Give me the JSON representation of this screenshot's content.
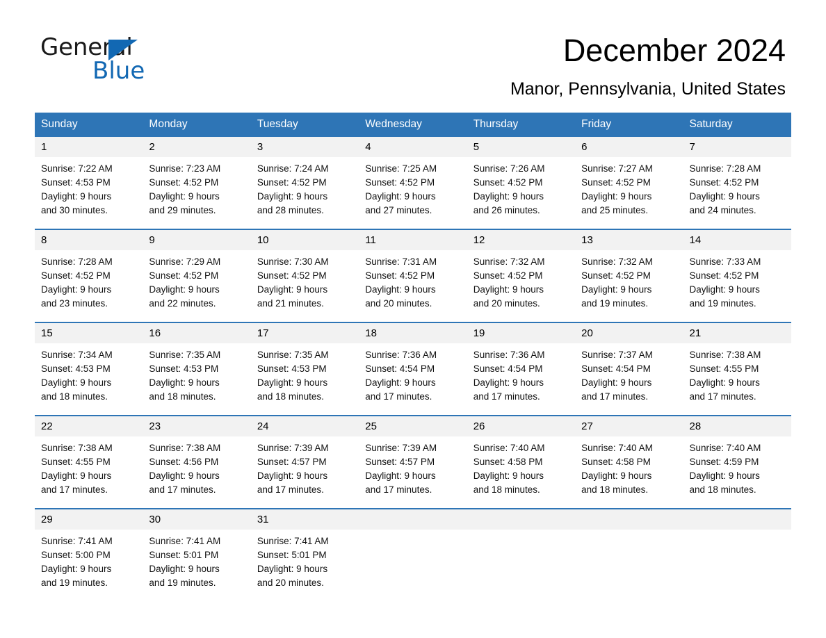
{
  "brand": {
    "name_part1": "General",
    "name_part2": "Blue",
    "triangle_color": "#1268b3"
  },
  "header": {
    "month_title": "December 2024",
    "location": "Manor, Pennsylvania, United States",
    "header_bg_color": "#2e75b6",
    "daynum_bg_color": "#f2f2f2"
  },
  "weekday_headers": [
    "Sunday",
    "Monday",
    "Tuesday",
    "Wednesday",
    "Thursday",
    "Friday",
    "Saturday"
  ],
  "weeks": [
    {
      "days": [
        {
          "num": "1",
          "sunrise": "Sunrise: 7:22 AM",
          "sunset": "Sunset: 4:53 PM",
          "daylight_l1": "Daylight: 9 hours",
          "daylight_l2": "and 30 minutes."
        },
        {
          "num": "2",
          "sunrise": "Sunrise: 7:23 AM",
          "sunset": "Sunset: 4:52 PM",
          "daylight_l1": "Daylight: 9 hours",
          "daylight_l2": "and 29 minutes."
        },
        {
          "num": "3",
          "sunrise": "Sunrise: 7:24 AM",
          "sunset": "Sunset: 4:52 PM",
          "daylight_l1": "Daylight: 9 hours",
          "daylight_l2": "and 28 minutes."
        },
        {
          "num": "4",
          "sunrise": "Sunrise: 7:25 AM",
          "sunset": "Sunset: 4:52 PM",
          "daylight_l1": "Daylight: 9 hours",
          "daylight_l2": "and 27 minutes."
        },
        {
          "num": "5",
          "sunrise": "Sunrise: 7:26 AM",
          "sunset": "Sunset: 4:52 PM",
          "daylight_l1": "Daylight: 9 hours",
          "daylight_l2": "and 26 minutes."
        },
        {
          "num": "6",
          "sunrise": "Sunrise: 7:27 AM",
          "sunset": "Sunset: 4:52 PM",
          "daylight_l1": "Daylight: 9 hours",
          "daylight_l2": "and 25 minutes."
        },
        {
          "num": "7",
          "sunrise": "Sunrise: 7:28 AM",
          "sunset": "Sunset: 4:52 PM",
          "daylight_l1": "Daylight: 9 hours",
          "daylight_l2": "and 24 minutes."
        }
      ]
    },
    {
      "days": [
        {
          "num": "8",
          "sunrise": "Sunrise: 7:28 AM",
          "sunset": "Sunset: 4:52 PM",
          "daylight_l1": "Daylight: 9 hours",
          "daylight_l2": "and 23 minutes."
        },
        {
          "num": "9",
          "sunrise": "Sunrise: 7:29 AM",
          "sunset": "Sunset: 4:52 PM",
          "daylight_l1": "Daylight: 9 hours",
          "daylight_l2": "and 22 minutes."
        },
        {
          "num": "10",
          "sunrise": "Sunrise: 7:30 AM",
          "sunset": "Sunset: 4:52 PM",
          "daylight_l1": "Daylight: 9 hours",
          "daylight_l2": "and 21 minutes."
        },
        {
          "num": "11",
          "sunrise": "Sunrise: 7:31 AM",
          "sunset": "Sunset: 4:52 PM",
          "daylight_l1": "Daylight: 9 hours",
          "daylight_l2": "and 20 minutes."
        },
        {
          "num": "12",
          "sunrise": "Sunrise: 7:32 AM",
          "sunset": "Sunset: 4:52 PM",
          "daylight_l1": "Daylight: 9 hours",
          "daylight_l2": "and 20 minutes."
        },
        {
          "num": "13",
          "sunrise": "Sunrise: 7:32 AM",
          "sunset": "Sunset: 4:52 PM",
          "daylight_l1": "Daylight: 9 hours",
          "daylight_l2": "and 19 minutes."
        },
        {
          "num": "14",
          "sunrise": "Sunrise: 7:33 AM",
          "sunset": "Sunset: 4:52 PM",
          "daylight_l1": "Daylight: 9 hours",
          "daylight_l2": "and 19 minutes."
        }
      ]
    },
    {
      "days": [
        {
          "num": "15",
          "sunrise": "Sunrise: 7:34 AM",
          "sunset": "Sunset: 4:53 PM",
          "daylight_l1": "Daylight: 9 hours",
          "daylight_l2": "and 18 minutes."
        },
        {
          "num": "16",
          "sunrise": "Sunrise: 7:35 AM",
          "sunset": "Sunset: 4:53 PM",
          "daylight_l1": "Daylight: 9 hours",
          "daylight_l2": "and 18 minutes."
        },
        {
          "num": "17",
          "sunrise": "Sunrise: 7:35 AM",
          "sunset": "Sunset: 4:53 PM",
          "daylight_l1": "Daylight: 9 hours",
          "daylight_l2": "and 18 minutes."
        },
        {
          "num": "18",
          "sunrise": "Sunrise: 7:36 AM",
          "sunset": "Sunset: 4:54 PM",
          "daylight_l1": "Daylight: 9 hours",
          "daylight_l2": "and 17 minutes."
        },
        {
          "num": "19",
          "sunrise": "Sunrise: 7:36 AM",
          "sunset": "Sunset: 4:54 PM",
          "daylight_l1": "Daylight: 9 hours",
          "daylight_l2": "and 17 minutes."
        },
        {
          "num": "20",
          "sunrise": "Sunrise: 7:37 AM",
          "sunset": "Sunset: 4:54 PM",
          "daylight_l1": "Daylight: 9 hours",
          "daylight_l2": "and 17 minutes."
        },
        {
          "num": "21",
          "sunrise": "Sunrise: 7:38 AM",
          "sunset": "Sunset: 4:55 PM",
          "daylight_l1": "Daylight: 9 hours",
          "daylight_l2": "and 17 minutes."
        }
      ]
    },
    {
      "days": [
        {
          "num": "22",
          "sunrise": "Sunrise: 7:38 AM",
          "sunset": "Sunset: 4:55 PM",
          "daylight_l1": "Daylight: 9 hours",
          "daylight_l2": "and 17 minutes."
        },
        {
          "num": "23",
          "sunrise": "Sunrise: 7:38 AM",
          "sunset": "Sunset: 4:56 PM",
          "daylight_l1": "Daylight: 9 hours",
          "daylight_l2": "and 17 minutes."
        },
        {
          "num": "24",
          "sunrise": "Sunrise: 7:39 AM",
          "sunset": "Sunset: 4:57 PM",
          "daylight_l1": "Daylight: 9 hours",
          "daylight_l2": "and 17 minutes."
        },
        {
          "num": "25",
          "sunrise": "Sunrise: 7:39 AM",
          "sunset": "Sunset: 4:57 PM",
          "daylight_l1": "Daylight: 9 hours",
          "daylight_l2": "and 17 minutes."
        },
        {
          "num": "26",
          "sunrise": "Sunrise: 7:40 AM",
          "sunset": "Sunset: 4:58 PM",
          "daylight_l1": "Daylight: 9 hours",
          "daylight_l2": "and 18 minutes."
        },
        {
          "num": "27",
          "sunrise": "Sunrise: 7:40 AM",
          "sunset": "Sunset: 4:58 PM",
          "daylight_l1": "Daylight: 9 hours",
          "daylight_l2": "and 18 minutes."
        },
        {
          "num": "28",
          "sunrise": "Sunrise: 7:40 AM",
          "sunset": "Sunset: 4:59 PM",
          "daylight_l1": "Daylight: 9 hours",
          "daylight_l2": "and 18 minutes."
        }
      ]
    },
    {
      "days": [
        {
          "num": "29",
          "sunrise": "Sunrise: 7:41 AM",
          "sunset": "Sunset: 5:00 PM",
          "daylight_l1": "Daylight: 9 hours",
          "daylight_l2": "and 19 minutes."
        },
        {
          "num": "30",
          "sunrise": "Sunrise: 7:41 AM",
          "sunset": "Sunset: 5:01 PM",
          "daylight_l1": "Daylight: 9 hours",
          "daylight_l2": "and 19 minutes."
        },
        {
          "num": "31",
          "sunrise": "Sunrise: 7:41 AM",
          "sunset": "Sunset: 5:01 PM",
          "daylight_l1": "Daylight: 9 hours",
          "daylight_l2": "and 20 minutes."
        },
        {
          "num": "",
          "sunrise": "",
          "sunset": "",
          "daylight_l1": "",
          "daylight_l2": ""
        },
        {
          "num": "",
          "sunrise": "",
          "sunset": "",
          "daylight_l1": "",
          "daylight_l2": ""
        },
        {
          "num": "",
          "sunrise": "",
          "sunset": "",
          "daylight_l1": "",
          "daylight_l2": ""
        },
        {
          "num": "",
          "sunrise": "",
          "sunset": "",
          "daylight_l1": "",
          "daylight_l2": ""
        }
      ]
    }
  ]
}
